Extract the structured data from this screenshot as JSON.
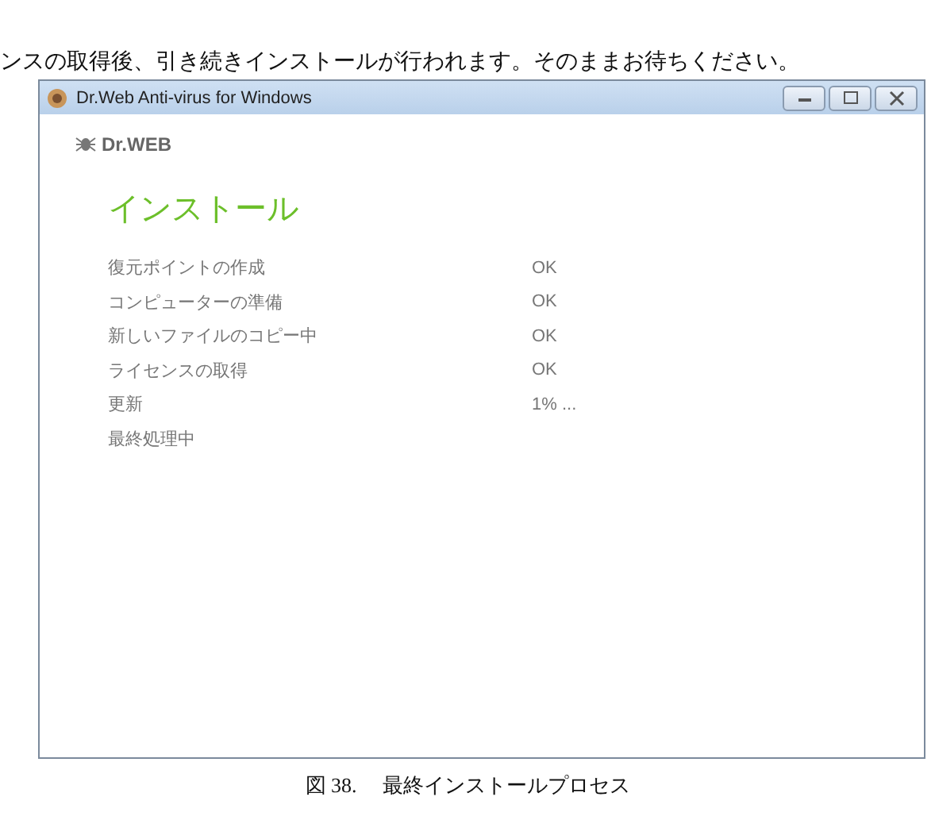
{
  "intro_text": "ンスの取得後、引き続きインストールが行われます。そのままお待ちください。",
  "window": {
    "title": "Dr.Web Anti-virus for Windows",
    "logo": "Dr.WEB",
    "heading": "インストール",
    "steps": [
      {
        "label": "復元ポイントの作成",
        "status": "OK"
      },
      {
        "label": "コンピューターの準備",
        "status": "OK"
      },
      {
        "label": "新しいファイルのコピー中",
        "status": "OK"
      },
      {
        "label": "ライセンスの取得",
        "status": "OK"
      },
      {
        "label": "更新",
        "status": "1% ..."
      },
      {
        "label": "最終処理中"
      }
    ]
  },
  "caption": {
    "number": "図 38.",
    "text": "最終インストールプロセス"
  }
}
